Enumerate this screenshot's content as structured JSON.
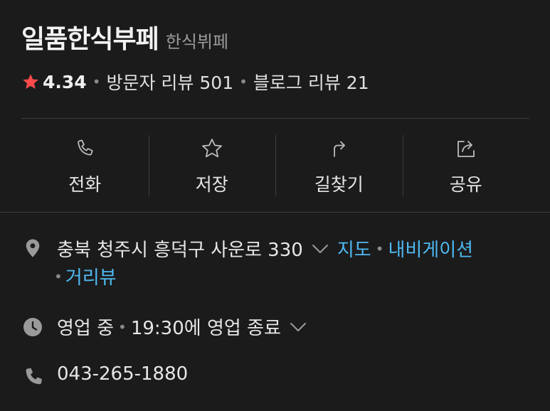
{
  "place": {
    "name": "일품한식부페",
    "category": "한식뷔페"
  },
  "rating": {
    "score": "4.34",
    "visitor_reviews": "방문자 리뷰 501",
    "blog_reviews": "블로그 리뷰 21",
    "star_color": "#ff4b4b"
  },
  "actions": [
    {
      "label": "전화",
      "icon": "phone-icon"
    },
    {
      "label": "저장",
      "icon": "star-outline-icon"
    },
    {
      "label": "길찾기",
      "icon": "directions-icon"
    },
    {
      "label": "공유",
      "icon": "share-icon"
    }
  ],
  "address": {
    "text": "충북 청주시 흥덕구 사운로 330",
    "map_link": "지도",
    "navigation_link": "내비게이션",
    "streetview_link": "거리뷰",
    "link_color": "#4fb9f0"
  },
  "hours": {
    "status": "영업 중",
    "detail": "19:30에 영업 종료"
  },
  "phone": {
    "number": "043-265-1880"
  }
}
